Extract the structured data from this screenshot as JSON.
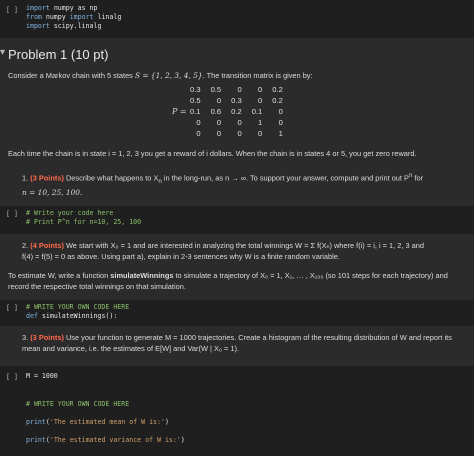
{
  "cells": {
    "c1": {
      "prompt": "[ ]",
      "lines": [
        "import numpy as np",
        "from numpy import linalg",
        "import scipy.linalg"
      ]
    },
    "heading": {
      "toggle": "▾",
      "title": "Problem 1 (10 pt)"
    },
    "intro": {
      "text_a": "Consider a Markov chain with 5 states ",
      "S_expr": "S = {1, 2, 3, 4, 5}",
      "text_b": ". The transition matrix is given by:",
      "matrix_label": "P =",
      "matrix": [
        [
          "0.3",
          "0.5",
          "0",
          "0",
          "0.2"
        ],
        [
          "0.5",
          "0",
          "0.3",
          "0",
          "0.2"
        ],
        [
          "0.1",
          "0.6",
          "0.2",
          "0.1",
          "0"
        ],
        [
          "0",
          "0",
          "0",
          "1",
          "0"
        ],
        [
          "0",
          "0",
          "0",
          "0",
          "1"
        ]
      ],
      "reward_text": "Each time the chain is in state i = 1, 2, 3 you get a reward of i dollars. When the chain is in states 4 or 5, you get zero reward."
    },
    "q1": {
      "num": "1.",
      "points": "(3 Points)",
      "text": " Describe what happens to X",
      "text2": " in the long-run, as n → ∞. To support your answer, compute and print out P",
      "text3": " for",
      "line2": "n = 10, 25, 100."
    },
    "c2": {
      "prompt": "[ ]",
      "lines": [
        "# Write your code here",
        "# Print P^n for n=10, 25, 100"
      ]
    },
    "q2": {
      "num": "2.",
      "points": "(4 Points)",
      "text": " We start with X₀ = 1 and are interested in analyzing the total winnings W = Σ f(Xₙ) where f(i) = i, i = 1, 2, 3 and",
      "line2": "f(4) = f(5) = 0 as above. Using part a), explain in 2-3 sentences why W is a finite random variable."
    },
    "estimate": {
      "text_a": "To estimate W, write a function ",
      "fn": "simulateWinnings",
      "text_b": " to simulate a trajectory of X₀ = 1, X₁, … , X₁₀₀ (so 101 steps for each trajectory) and",
      "line2": "record the respective total winnings on that simulation."
    },
    "c3": {
      "prompt": "[ ]",
      "lines": [
        "# WRITE YOUR OWN CODE HERE",
        "def simulateWinnings():"
      ]
    },
    "q3": {
      "num": "3.",
      "points": "(3 Points)",
      "text": " Use your function to generate M = 1000 trajectories. Create a histogram of the resulting distribution of W and report its",
      "line2": "mean and variance, i.e. the estimates of E[W] and Var(W | X₀ = 1)."
    },
    "c4": {
      "prompt": "[ ]",
      "lines": [
        "M = 1000",
        "",
        "",
        "# WRITE YOUR OWN CODE HERE",
        "",
        "print('The estimated mean of W is:')",
        "",
        "print('The estimated variance of W is:')"
      ]
    }
  }
}
